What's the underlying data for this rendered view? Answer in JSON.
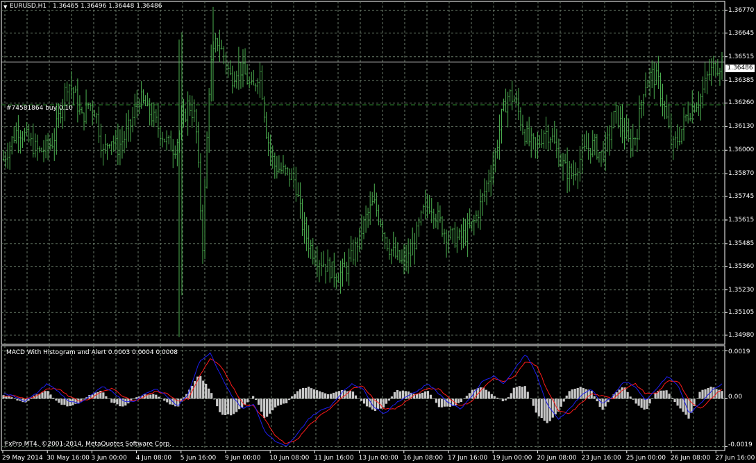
{
  "chart_header": {
    "symbol_timeframe": "EURUSD,H1",
    "ohlc": "1.36465 1.36496 1.36448 1.36486"
  },
  "current_price": "1.36486",
  "order_label": "#74581864 buy 0.10",
  "macd_panel": {
    "title": "MACD With Histogram and Alert 0.0003 0.0004 0.0008",
    "y_labels": [
      "0.0019",
      "0.00",
      "-0.0019"
    ]
  },
  "copyright": "FxPro MT4, ©2001-2014, MetaQuotes Software Corp.",
  "price_axis_labels": [
    "1.36770",
    "1.36645",
    "1.36515",
    "1.36385",
    "1.36260",
    "1.36130",
    "1.36000",
    "1.35870",
    "1.35745",
    "1.35615",
    "1.35485",
    "1.35360",
    "1.35230",
    "1.35105",
    "1.34980"
  ],
  "time_axis_labels": [
    "29 May 2014",
    "30 May 16:00",
    "3 Jun 00:00",
    "4 Jun 08:00",
    "5 Jun 16:00",
    "9 Jun 00:00",
    "10 Jun 08:00",
    "11 Jun 16:00",
    "13 Jun 00:00",
    "16 Jun 08:00",
    "17 Jun 16:00",
    "19 Jun 00:00",
    "20 Jun 08:00",
    "23 Jun 16:00",
    "25 Jun 00:00",
    "26 Jun 08:00",
    "27 Jun 16:00"
  ],
  "colors": {
    "background": "#000000",
    "grid": "#6b7d6b",
    "bars": "#4caf50",
    "macd_line": "#1d1df0",
    "signal_line": "#ff1a1a",
    "histogram": "#c8c8c8"
  },
  "chart_data": [
    {
      "type": "ohlc",
      "title": "EURUSD,H1",
      "ylim": [
        1.3493,
        1.3682
      ],
      "x_ticks": [
        "29 May 2014",
        "30 May 16:00",
        "3 Jun 00:00",
        "4 Jun 08:00",
        "5 Jun 16:00",
        "9 Jun 00:00",
        "10 Jun 08:00",
        "11 Jun 16:00",
        "13 Jun 00:00",
        "16 Jun 08:00",
        "17 Jun 16:00",
        "19 Jun 00:00",
        "20 Jun 08:00",
        "23 Jun 16:00",
        "25 Jun 00:00",
        "26 Jun 08:00",
        "27 Jun 16:00"
      ],
      "y_ticks": [
        1.3677,
        1.36645,
        1.36515,
        1.36385,
        1.3626,
        1.3613,
        1.36,
        1.3587,
        1.35745,
        1.35615,
        1.35485,
        1.3536,
        1.3523,
        1.35105,
        1.3498
      ],
      "close_profile": [
        1.3595,
        1.3604,
        1.3612,
        1.3608,
        1.3603,
        1.3599,
        1.3601,
        1.3605,
        1.3622,
        1.3638,
        1.3631,
        1.3617,
        1.3626,
        1.3621,
        1.3598,
        1.3608,
        1.3601,
        1.3607,
        1.3615,
        1.3629,
        1.3624,
        1.3618,
        1.3611,
        1.3604,
        1.3601,
        1.3612,
        1.3626,
        1.3617,
        1.3548,
        1.3644,
        1.3661,
        1.3652,
        1.3639,
        1.3647,
        1.3641,
        1.3632,
        1.3645,
        1.3609,
        1.3592,
        1.3589,
        1.3587,
        1.3583,
        1.3559,
        1.3548,
        1.3541,
        1.3538,
        1.3534,
        1.3531,
        1.3534,
        1.3541,
        1.3552,
        1.3563,
        1.3571,
        1.3562,
        1.3548,
        1.3542,
        1.3538,
        1.3541,
        1.3552,
        1.3566,
        1.3571,
        1.3563,
        1.3555,
        1.3552,
        1.3551,
        1.3554,
        1.3559,
        1.3569,
        1.3582,
        1.3595,
        1.3618,
        1.3631,
        1.3627,
        1.3612,
        1.3604,
        1.3601,
        1.3611,
        1.3608,
        1.3597,
        1.3589,
        1.3586,
        1.3595,
        1.3601,
        1.3603,
        1.3597,
        1.3605,
        1.3621,
        1.3612,
        1.3603,
        1.3609,
        1.3635,
        1.3642,
        1.3638,
        1.3622,
        1.3601,
        1.3608,
        1.3619,
        1.3625,
        1.3629,
        1.3641,
        1.3646,
        1.3648
      ],
      "current": 1.36486,
      "order_line": 1.3625
    },
    {
      "type": "macd",
      "title": "MACD With Histogram and Alert 0.0003 0.0004 0.0008",
      "ylim": [
        -0.00205,
        0.0021
      ],
      "y_ticks": [
        0.0019,
        0.0,
        -0.0019
      ],
      "macd_profile": [
        0.0002,
        0.0001,
        -0.0001,
        0.0002,
        0.0006,
        0.0003,
        -0.0001,
        -0.0002,
        0.0001,
        0.0005,
        0.0003,
        -0.0001,
        -0.0001,
        0.0002,
        0.0004,
        0.0001,
        -0.0003,
        0.0002,
        0.0015,
        0.0018,
        0.0009,
        0.0001,
        -0.0004,
        -0.0002,
        -0.0013,
        -0.0017,
        -0.0019,
        -0.0014,
        -0.0008,
        -0.0005,
        -0.0003,
        0.0002,
        0.0006,
        0.0004,
        -0.0003,
        -0.0006,
        -0.0002,
        0.0001,
        0.0003,
        0.0006,
        0.0002,
        -0.0002,
        -0.0004,
        0.0001,
        0.0007,
        0.0009,
        0.0006,
        0.0012,
        0.0018,
        0.0009,
        -0.0003,
        -0.0008,
        -0.0004,
        0.0001,
        0.0004,
        -0.0002,
        0.0001,
        0.0007,
        0.0005,
        -0.0001,
        0.0004,
        0.0009,
        0.0005,
        -0.0006,
        -0.0002,
        0.0003,
        0.0006
      ],
      "signal_profile": [
        0.0001,
        0.0001,
        0.0,
        0.0001,
        0.0004,
        0.0004,
        0.0001,
        -0.0001,
        0.0,
        0.0003,
        0.0004,
        0.0001,
        -0.0001,
        0.0001,
        0.0003,
        0.0002,
        -0.0001,
        0.0,
        0.0009,
        0.0016,
        0.0013,
        0.0005,
        -0.0002,
        -0.0003,
        -0.0008,
        -0.0015,
        -0.0018,
        -0.0016,
        -0.0011,
        -0.0007,
        -0.0004,
        0.0,
        0.0004,
        0.0005,
        0.0,
        -0.0004,
        -0.0004,
        -0.0001,
        0.0002,
        0.0004,
        0.0004,
        0.0,
        -0.0003,
        -0.0001,
        0.0004,
        0.0008,
        0.0007,
        0.0009,
        0.0015,
        0.0013,
        0.0003,
        -0.0005,
        -0.0006,
        -0.0002,
        0.0002,
        0.0001,
        0.0,
        0.0004,
        0.0006,
        0.0002,
        0.0002,
        0.0007,
        0.0007,
        -0.0001,
        -0.0004,
        0.0,
        0.0004
      ]
    }
  ]
}
